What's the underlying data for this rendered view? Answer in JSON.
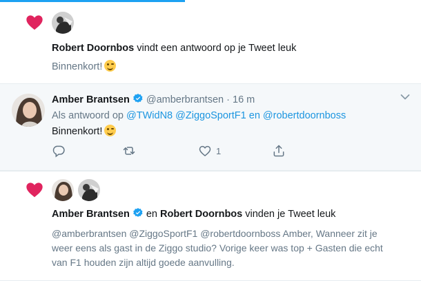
{
  "notification1": {
    "actor_name": "Robert Doornbos",
    "action_text": "vindt een antwoord op je Tweet leuk",
    "tweet_text": "Binnenkort!"
  },
  "reply": {
    "name": "Amber Brantsen",
    "handle": "@amberbrantsen",
    "separator": "·",
    "time": "16 m",
    "reply_prefix": "Als antwoord op",
    "mention1": "@TWidN8",
    "mention2": "@ZiggoSportF1",
    "conjunction": "en",
    "mention3": "@robertdoornboss",
    "text": "Binnenkort!",
    "like_count": "1"
  },
  "notification2": {
    "actor1_name": "Amber Brantsen",
    "conjunction": "en",
    "actor2_name": "Robert Doornbos",
    "action_text": "vinden je Tweet leuk",
    "tweet_text": "@amberbrantsen @ZiggoSportF1 @robertdoornboss Amber, Wanneer zit je weer eens als gast in de Ziggo studio? Vorige keer was top + Gasten die echt van F1 houden zijn altijd goede aanvulling."
  },
  "colors": {
    "heart": "#e0245e",
    "link": "#1b95e0",
    "verified": "#1da1f2",
    "muted": "#657786"
  },
  "icons": [
    "heart-icon",
    "verified-badge-icon",
    "reply-icon",
    "retweet-icon",
    "like-icon",
    "share-icon",
    "chevron-down-icon",
    "wink-emoji"
  ]
}
